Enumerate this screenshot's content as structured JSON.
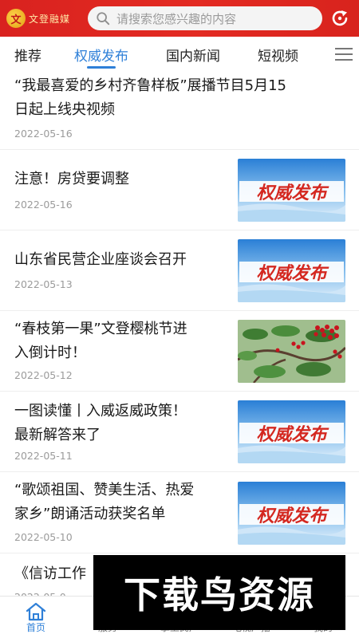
{
  "header": {
    "logo_mark": "文",
    "logo_text": "文登融媒",
    "search_placeholder": "请搜索您感兴趣的内容",
    "brand_color": "#e02a22"
  },
  "tabs": [
    {
      "label": "推荐",
      "active": false
    },
    {
      "label": "权威发布",
      "active": true
    },
    {
      "label": "国内新闻",
      "active": false
    },
    {
      "label": "短视频",
      "active": false
    }
  ],
  "accent_color": "#2f80d8",
  "news": [
    {
      "title_lines": [
        "“我最喜爱的乡村齐鲁样板”展播节目5月15",
        "日起上线央视频"
      ],
      "date": "2022-05-16",
      "thumb": "none"
    },
    {
      "title_lines": [
        "注意！房贷要调整"
      ],
      "date": "2022-05-16",
      "thumb": "quanwei"
    },
    {
      "title_lines": [
        "山东省民营企业座谈会召开"
      ],
      "date": "2022-05-13",
      "thumb": "quanwei"
    },
    {
      "title_lines": [
        "“春枝第一果”文登樱桃节进",
        "入倒计时！"
      ],
      "date": "2022-05-12",
      "thumb": "cherry"
    },
    {
      "title_lines": [
        "一图读懂丨入威返威政策！",
        "最新解答来了"
      ],
      "date": "2022-05-11",
      "thumb": "quanwei"
    },
    {
      "title_lines": [
        "“歌颂祖国、赞美生活、热爱",
        "家乡”朗诵活动获奖名单"
      ],
      "date": "2022-05-10",
      "thumb": "quanwei"
    },
    {
      "title_lines": [
        "《信访工作"
      ],
      "date": "2022-05-0",
      "thumb": "none"
    }
  ],
  "thumb_label": "权威发布",
  "bottom_nav": [
    {
      "label": "首页",
      "icon": "home-icon",
      "active": true
    },
    {
      "label": "服务",
      "icon": "service-icon",
      "active": false
    },
    {
      "label": "掌上民声",
      "icon": "voice-icon",
      "active": false
    },
    {
      "label": "电视广播",
      "icon": "tv-icon",
      "active": false
    },
    {
      "label": "我的",
      "icon": "user-icon",
      "active": false
    }
  ],
  "watermark": "下载鸟资源"
}
